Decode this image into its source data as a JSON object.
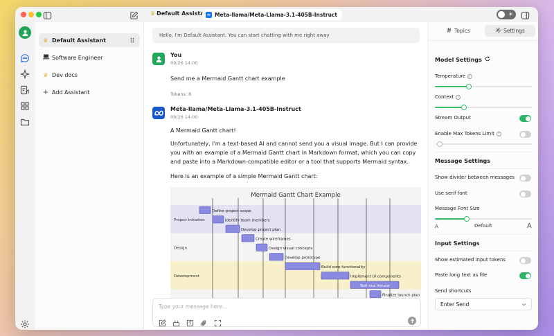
{
  "titlebar": {
    "assistant_name": "Default Assistant",
    "model_name": "Meta-llama/Meta-Llama-3.1-405B-Instruct"
  },
  "assistants": {
    "items": [
      {
        "label": "Default Assistant",
        "icon": "crown-icon",
        "active": true
      },
      {
        "label": "Software Engineer",
        "icon": "laptop-icon",
        "active": false
      },
      {
        "label": "Dev docs",
        "icon": "crown-icon",
        "active": false
      }
    ],
    "add_label": "Add Assistant"
  },
  "chat": {
    "greeting": "Hello, I'm Default Assistant. You can start chatting with me right away",
    "user_message": {
      "name": "You",
      "time": "09/26 14:00",
      "text": "Send me a Mermaid Gantt chart example",
      "tokens": "Tokens: 8"
    },
    "bot_message": {
      "name": "Meta-llama/Meta-Llama-3.1-405B-Instruct",
      "time": "09/26 14:00",
      "p1": "A Mermaid Gantt chart!",
      "p2": "Unfortunately, I'm a text-based AI and cannot send you a visual image. But I can provide you with an example of a Mermaid Gantt chart in Markdown format, which you can copy and paste into a Markdown-compatible editor or a tool that supports Mermaid syntax.",
      "p3": "Here is an example of a simple Mermaid Gantt chart:"
    },
    "input_placeholder": "Type your message here..."
  },
  "chart_data": {
    "type": "gantt",
    "title": "Mermaid Gantt Chart Example",
    "sections": [
      {
        "name": "Project Initiation",
        "tasks": [
          "Define project scope",
          "Identify team members",
          "Develop project plan"
        ]
      },
      {
        "name": "Design",
        "tasks": [
          "Create wireframes",
          "Design visual concepts",
          "Develop prototype"
        ]
      },
      {
        "name": "Development",
        "tasks": [
          "Build core functionality",
          "Implement UI components",
          "Test and iterate"
        ]
      },
      {
        "name": "",
        "tasks": [
          "Finalize launch plan"
        ]
      }
    ],
    "colors": {
      "bar": "#8a8ae0",
      "bar_border": "#5252b8",
      "section_a": "#e2e2f2",
      "section_b": "#f8f0c8"
    }
  },
  "settings": {
    "tabs": {
      "topics": "Topics",
      "settings": "Settings"
    },
    "model_settings": {
      "title": "Model Settings",
      "temperature": {
        "label": "Temperature",
        "value": 0.35
      },
      "context": {
        "label": "Context",
        "value": 0.3
      },
      "stream_output": {
        "label": "Stream Output",
        "on": true
      },
      "max_tokens": {
        "label": "Enable Max Tokens Limit",
        "on": false,
        "value": 0.05
      }
    },
    "message_settings": {
      "title": "Message Settings",
      "divider": {
        "label": "Show divider between messages",
        "on": false
      },
      "serif": {
        "label": "Use serif font",
        "on": false
      },
      "font_size": {
        "label": "Message Font Size",
        "small": "A",
        "large": "A",
        "current": "Default",
        "value": 0.33
      }
    },
    "input_settings": {
      "title": "Input Settings",
      "estimated_tokens": {
        "label": "Show estimated input tokens",
        "on": false
      },
      "paste_long": {
        "label": "Paste long text as file",
        "on": true
      },
      "send_shortcuts": {
        "label": "Send shortcuts",
        "value": "Enter Send"
      }
    }
  },
  "colors": {
    "accent": "#2fb568",
    "bot_avatar": "#1858c8",
    "gantt_bar": "#8a8ae0"
  }
}
